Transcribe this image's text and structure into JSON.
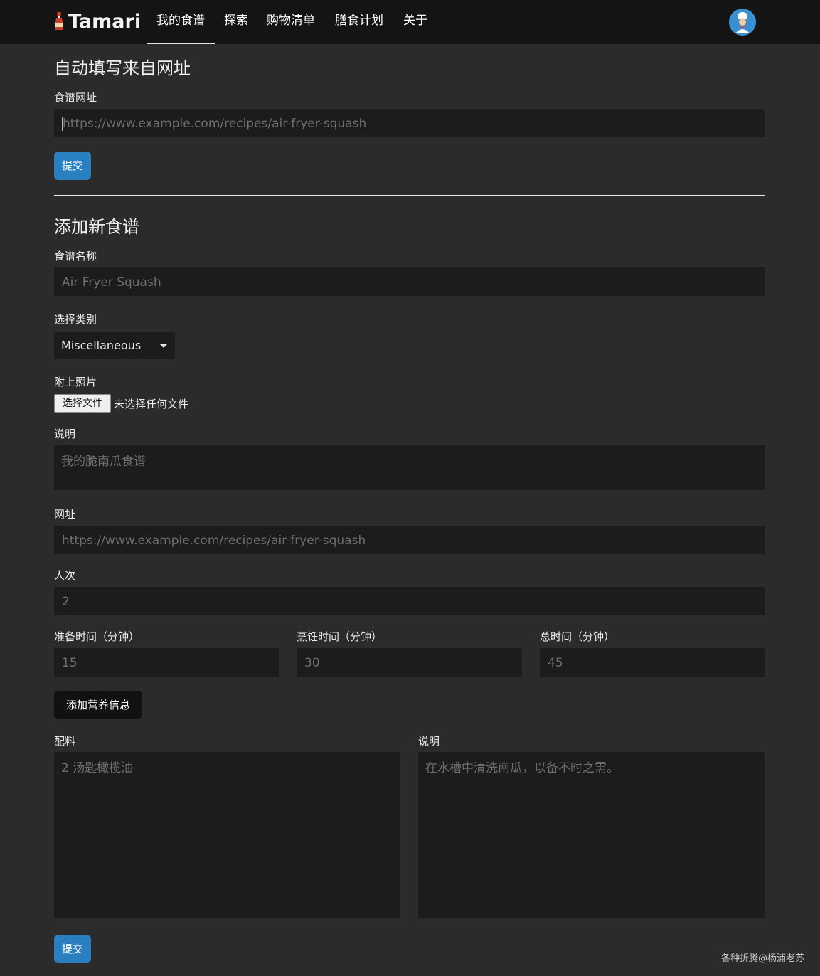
{
  "app": {
    "brand": "Tamari"
  },
  "nav": {
    "items": [
      {
        "label": "我的食谱"
      },
      {
        "label": "探索"
      },
      {
        "label": "购物清单"
      },
      {
        "label": "膳食计划"
      },
      {
        "label": "关于"
      }
    ]
  },
  "autofill": {
    "heading": "自动填写来自网址",
    "url_label": "食谱网址",
    "url_placeholder": "https://www.example.com/recipes/air-fryer-squash",
    "submit_label": "提交"
  },
  "new_recipe": {
    "heading": "添加新食谱",
    "name_label": "食谱名称",
    "name_placeholder": "Air Fryer Squash",
    "category_label": "选择类别",
    "category_selected": "Miscellaneous",
    "photo_label": "附上照片",
    "file_button_label": "选择文件",
    "file_status": "未选择任何文件",
    "description_label": "说明",
    "description_placeholder": "我的脆南瓜食谱",
    "url_label": "网址",
    "url_placeholder": "https://www.example.com/recipes/air-fryer-squash",
    "servings_label": "人次",
    "servings_placeholder": "2",
    "prep_label": "准备时间（分钟）",
    "prep_placeholder": "15",
    "cook_label": "烹饪时间（分钟）",
    "cook_placeholder": "30",
    "total_label": "总时间（分钟）",
    "total_placeholder": "45",
    "nutrition_button": "添加营养信息",
    "ingredients_label": "配料",
    "ingredients_placeholder": "2 汤匙橄榄油",
    "instructions_label": "说明",
    "instructions_placeholder": "在水槽中清洗南瓜，以备不时之需。",
    "submit_label": "提交"
  },
  "footer": {
    "watermark": "各种折腾@杨浦老苏"
  },
  "colors": {
    "background": "#2b2b2b",
    "navbar": "#141414",
    "input_bg": "#1c1c1c",
    "primary": "#2a7fc0"
  }
}
